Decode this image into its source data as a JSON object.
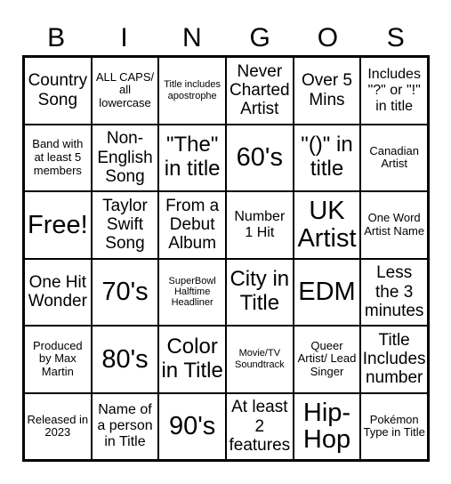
{
  "header": [
    "B",
    "I",
    "N",
    "G",
    "O",
    "S"
  ],
  "rows": [
    [
      {
        "text": "Country Song",
        "size": "l"
      },
      {
        "text": "ALL CAPS/ all lowercase",
        "size": "s"
      },
      {
        "text": "Title includes apostrophe",
        "size": "xs"
      },
      {
        "text": "Never Charted Artist",
        "size": "l"
      },
      {
        "text": "Over 5 Mins",
        "size": "l"
      },
      {
        "text": "Includes \"?\" or \"!\" in title",
        "size": "m"
      }
    ],
    [
      {
        "text": "Band with at least 5 members",
        "size": "s"
      },
      {
        "text": "Non-English Song",
        "size": "l"
      },
      {
        "text": "\"The\" in title",
        "size": "xl"
      },
      {
        "text": "60's",
        "size": "xxl"
      },
      {
        "text": "\"()\" in title",
        "size": "xl"
      },
      {
        "text": "Canadian Artist",
        "size": "s"
      }
    ],
    [
      {
        "text": "Free!",
        "size": "xxl"
      },
      {
        "text": "Taylor Swift Song",
        "size": "l"
      },
      {
        "text": "From a Debut Album",
        "size": "l"
      },
      {
        "text": "Number 1 Hit",
        "size": "m"
      },
      {
        "text": "UK Artist",
        "size": "xxl"
      },
      {
        "text": "One Word Artist Name",
        "size": "s"
      }
    ],
    [
      {
        "text": "One Hit Wonder",
        "size": "l"
      },
      {
        "text": "70's",
        "size": "xxl"
      },
      {
        "text": "SuperBowl Halftime Headliner",
        "size": "xs"
      },
      {
        "text": "City in Title",
        "size": "xl"
      },
      {
        "text": "EDM",
        "size": "xxl"
      },
      {
        "text": "Less the 3 minutes",
        "size": "l"
      }
    ],
    [
      {
        "text": "Produced by Max Martin",
        "size": "s"
      },
      {
        "text": "80's",
        "size": "xxl"
      },
      {
        "text": "Color in Title",
        "size": "xl"
      },
      {
        "text": "Movie/TV Soundtrack",
        "size": "xs"
      },
      {
        "text": "Queer Artist/ Lead Singer",
        "size": "s"
      },
      {
        "text": "Title Includes number",
        "size": "l"
      }
    ],
    [
      {
        "text": "Released in 2023",
        "size": "s"
      },
      {
        "text": "Name of a person in Title",
        "size": "m"
      },
      {
        "text": "90's",
        "size": "xxl"
      },
      {
        "text": "At least 2 features",
        "size": "l"
      },
      {
        "text": "Hip-Hop",
        "size": "xxl"
      },
      {
        "text": "Pokémon Type in Title",
        "size": "s"
      }
    ]
  ]
}
